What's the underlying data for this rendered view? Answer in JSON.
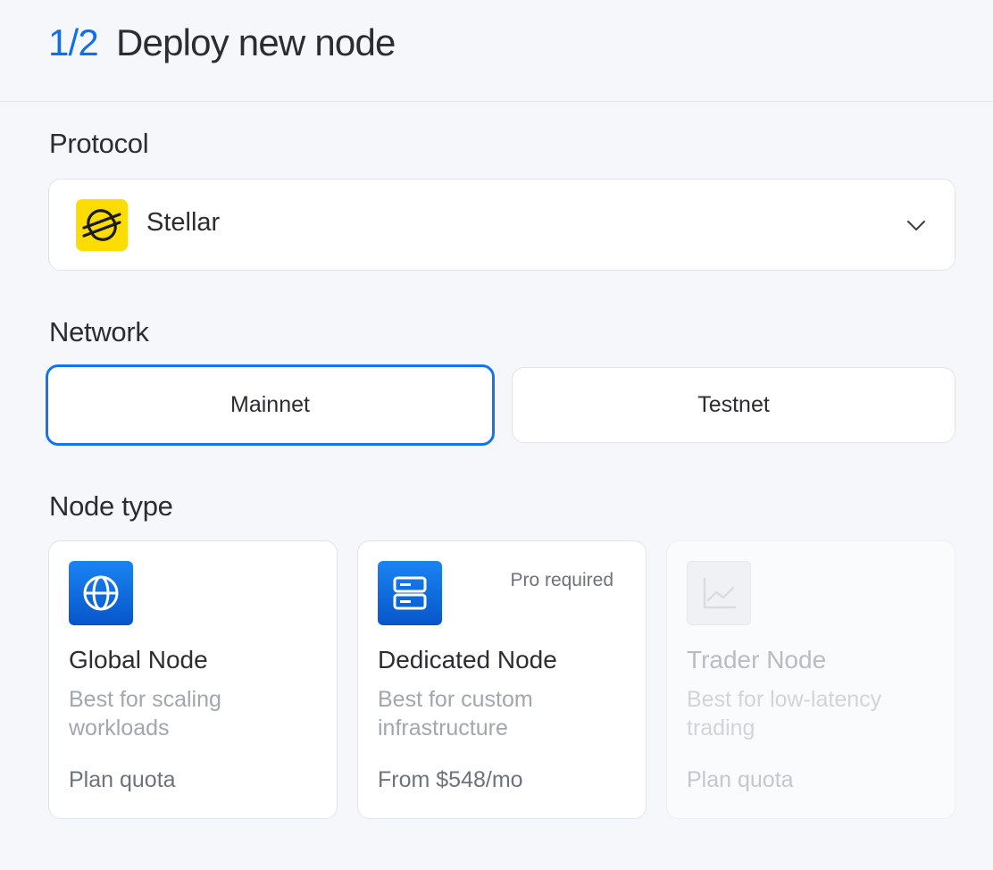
{
  "header": {
    "step": "1/2",
    "title": "Deploy new node"
  },
  "protocol": {
    "label": "Protocol",
    "selected": "Stellar",
    "logo_icon": "stellar-logo-icon",
    "logo_color": "#fddc02"
  },
  "network": {
    "label": "Network",
    "options": [
      {
        "label": "Mainnet",
        "selected": true
      },
      {
        "label": "Testnet",
        "selected": false
      }
    ],
    "accent": "#1274ef"
  },
  "node_type": {
    "label": "Node type",
    "cards": [
      {
        "name": "Global Node",
        "description": "Best for scaling workloads",
        "price": "Plan quota",
        "icon": "globe-icon",
        "badge": ""
      },
      {
        "name": "Dedicated Node",
        "description": "Best for custom infrastructure",
        "price": "From $548/mo",
        "icon": "server-icon",
        "badge": "Pro required"
      },
      {
        "name": "Trader Node",
        "description": "Best for low-latency trading",
        "price": "Plan quota",
        "icon": "chart-line-icon",
        "badge": "",
        "disabled": true
      }
    ]
  }
}
